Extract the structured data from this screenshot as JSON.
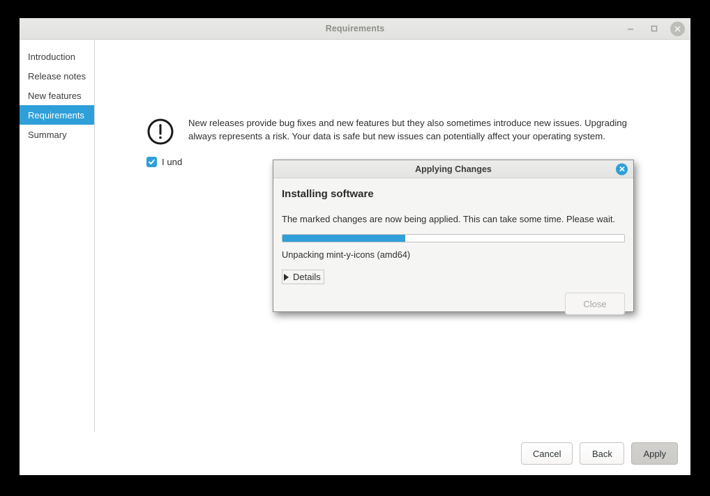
{
  "window": {
    "title": "Requirements",
    "controls": {
      "minimize": "minimize-icon",
      "maximize": "maximize-icon",
      "close": "close-icon"
    }
  },
  "sidebar": {
    "items": [
      {
        "label": "Introduction",
        "selected": false
      },
      {
        "label": "Release notes",
        "selected": false
      },
      {
        "label": "New features",
        "selected": false
      },
      {
        "label": "Requirements",
        "selected": true
      },
      {
        "label": "Summary",
        "selected": false
      }
    ]
  },
  "content": {
    "warning_icon": "warning-exclamation-icon",
    "warning_text": "New releases provide bug fixes and new features but they also sometimes introduce new issues. Upgrading always represents a risk. Your data is safe but new issues can potentially affect your operating system.",
    "checkbox": {
      "checked": true,
      "label": "I und"
    }
  },
  "footer": {
    "cancel_label": "Cancel",
    "back_label": "Back",
    "apply_label": "Apply"
  },
  "dialog": {
    "title": "Applying Changes",
    "close_icon": "close-icon",
    "heading": "Installing software",
    "description": "The marked changes are now being applied. This can take some time. Please wait.",
    "progress": {
      "percent": 36,
      "fill_color": "#2e9fd8"
    },
    "status": "Unpacking mint-y-icons (amd64)",
    "details_label": "Details",
    "details_expanded": false,
    "close_button_label": "Close",
    "close_button_enabled": false
  },
  "colors": {
    "accent": "#2e9fd8",
    "window_bg": "#ffffff",
    "dialog_bg": "#f5f5f4"
  }
}
